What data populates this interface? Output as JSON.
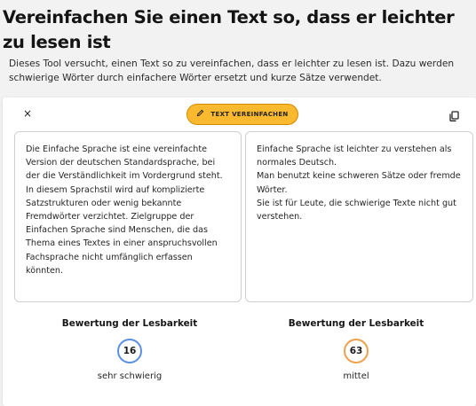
{
  "header": {
    "title": "Vereinfachen Sie einen Text so, dass er leichter zu lesen ist",
    "description": "Dieses Tool versucht, einen Text so zu vereinfachen, dass er leichter zu lesen ist. Dazu werden schwierige Wörter durch einfachere Wörter ersetzt und kurze Sätze verwendet."
  },
  "toolbar": {
    "close_icon": "close-icon",
    "close_symbol": "×",
    "simplify_label": "TEXT VEREINFACHEN",
    "simplify_icon": "pencil-icon",
    "copy_icon": "copy-icon",
    "accent_color": "#fbb930"
  },
  "input_text": "Die Einfache Sprache ist eine vereinfachte Version der deutschen Standardsprache, bei der die Verständlichkeit im Vordergrund steht. In diesem Sprachstil wird auf komplizierte Satzstrukturen oder wenig bekannte Fremdwörter verzichtet. Zielgruppe der Einfachen Sprache sind Menschen, die das Thema eines Textes in einer anspruchsvollen Fachsprache nicht umfänglich erfassen könnten.",
  "output_text": "Einfache Sprache ist leichter zu verstehen als normales Deutsch.\nMan benutzt keine schweren Sätze oder fremde Wörter.\nSie ist für Leute, die schwierige Texte nicht gut verstehen.",
  "scores": [
    {
      "title": "Bewertung der Lesbarkeit",
      "value": "16",
      "label": "sehr schwierig",
      "color": "#5b8fe3"
    },
    {
      "title": "Bewertung der Lesbarkeit",
      "value": "63",
      "label": "mittel",
      "color": "#f0a04b"
    }
  ]
}
